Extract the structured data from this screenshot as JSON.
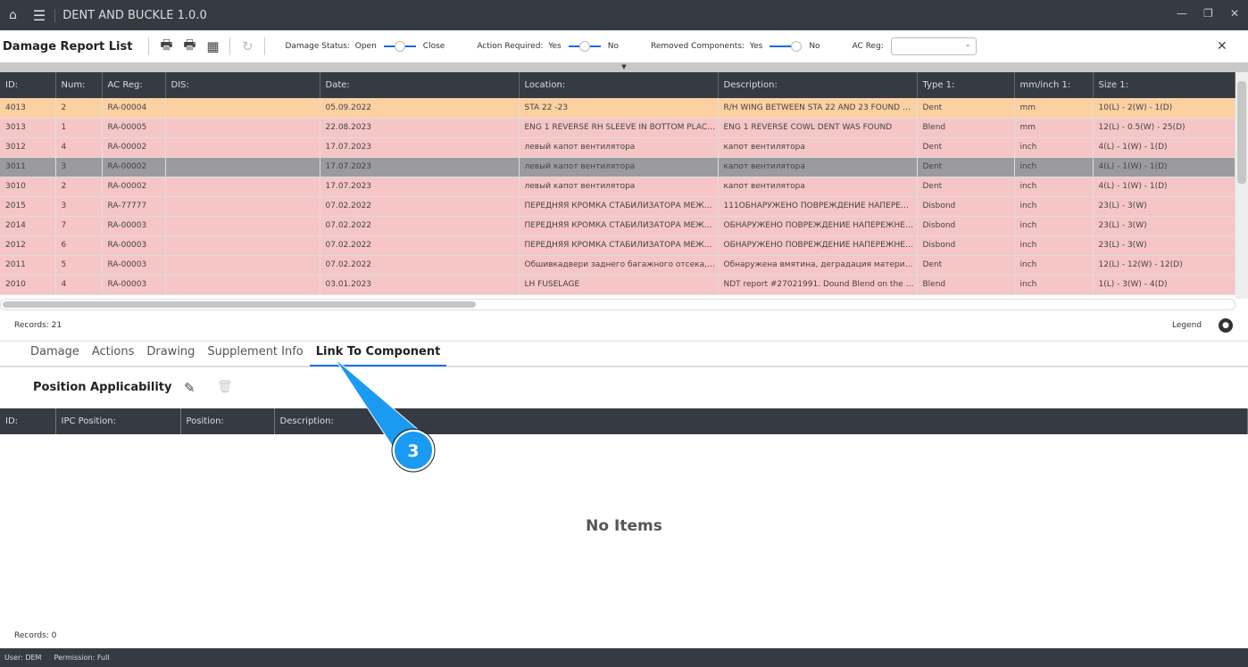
{
  "app": {
    "title": "DENT AND BUCKLE 1.0.0"
  },
  "toolbar": {
    "title": "Damage Report List",
    "damage_status": {
      "label": "Damage Status:",
      "left": "Open",
      "right": "Close"
    },
    "action_required": {
      "label": "Action Required:",
      "left": "Yes",
      "right": "No"
    },
    "removed_components": {
      "label": "Removed Components:",
      "left": "Yes",
      "right": "No"
    },
    "ac_reg": {
      "label": "AC Reg:",
      "value": ""
    },
    "close": "✕"
  },
  "grid": {
    "columns": [
      "ID:",
      "Num:",
      "AC Reg:",
      "DIS:",
      "Date:",
      "Location:",
      "Description:",
      "Type 1:",
      "mm/inch 1:",
      "Size 1:"
    ],
    "rows": [
      {
        "state": "orange",
        "cells": [
          "4013",
          "2",
          "RA-00004",
          "",
          "05.09.2022",
          "STA 22 -23",
          "R/H WING BETWEEN STA 22 AND 23 FOUND DE...",
          "Dent",
          "mm",
          "10(L) - 2(W) - 1(D)"
        ]
      },
      {
        "state": "pink",
        "cells": [
          "3013",
          "1",
          "RA-00005",
          "",
          "22.08.2023",
          "ENG 1 REVERSE RH SLEEVE IN BOTTOM PLACE...",
          "ENG 1 REVERSE COWL DENT WAS FOUND",
          "Blend",
          "mm",
          "12(L) - 0.5(W) - 25(D)"
        ]
      },
      {
        "state": "pink",
        "cells": [
          "3012",
          "4",
          "RA-00002",
          "",
          "17.07.2023",
          "левый капот вентилятора",
          "капот вентилятора",
          "Dent",
          "inch",
          "4(L) - 1(W) - 1(D)"
        ]
      },
      {
        "state": "sel",
        "cells": [
          "3011",
          "3",
          "RA-00002",
          "",
          "17.07.2023",
          "левый капот вентилятора",
          "капот вентилятора",
          "Dent",
          "inch",
          "4(L) - 1(W) - 1(D)"
        ]
      },
      {
        "state": "pink",
        "cells": [
          "3010",
          "2",
          "RA-00002",
          "",
          "17.07.2023",
          "левый капот вентилятора",
          "капот вентилятора",
          "Dent",
          "inch",
          "4(L) - 1(W) - 1(D)"
        ]
      },
      {
        "state": "pink",
        "cells": [
          "2015",
          "3",
          "RA-77777",
          "",
          "07.02.2022",
          "ПЕРЕДНЯЯ КРОМКА СТАБИЛИЗАТОРА МЕЖДУ...",
          "111ОБНАРУЖЕНО ПОВРЕЖДЕНИЕ НАПЕРЕЖН...",
          "Disbond",
          "inch",
          "23(L) - 3(W)"
        ]
      },
      {
        "state": "pink",
        "cells": [
          "2014",
          "7",
          "RA-00003",
          "",
          "07.02.2022",
          "ПЕРЕДНЯЯ КРОМКА СТАБИЛИЗАТОРА МЕЖДУ...",
          "ОБНАРУЖЕНО ПОВРЕЖДЕНИЕ НАПЕРЕЖНЕЙ...",
          "Disbond",
          "inch",
          "23(L) - 3(W)"
        ]
      },
      {
        "state": "pink",
        "cells": [
          "2012",
          "6",
          "RA-00003",
          "",
          "07.02.2022",
          "ПЕРЕДНЯЯ КРОМКА СТАБИЛИЗАТОРА МЕЖДУ...",
          "ОБНАРУЖЕНО ПОВРЕЖДЕНИЕ НАПЕРЕЖНЕЙ...",
          "Disbond",
          "inch",
          "23(L) - 3(W)"
        ]
      },
      {
        "state": "pink",
        "cells": [
          "2011",
          "5",
          "RA-00003",
          "",
          "07.02.2022",
          "Обшивкадвери заднего багажного отсека, ме...",
          "Обнаружена вмятина,  деградация материала...",
          "Dent",
          "inch",
          "12(L) - 12(W) - 12(D)"
        ]
      },
      {
        "state": "pink",
        "cells": [
          "2010",
          "4",
          "RA-00003",
          "",
          "03.01.2023",
          "LH FUSELAGE",
          "NDT report #27021991. Dound Blend on the fus...",
          "Blend",
          "inch",
          "1(L) - 3(W) - 4(D)"
        ]
      }
    ],
    "records": "Records: 21",
    "legend": "Legend"
  },
  "tabs": [
    "Damage",
    "Actions",
    "Drawing",
    "Supplement Info",
    "Link To Component"
  ],
  "position": {
    "title": "Position Applicability",
    "columns": [
      "ID:",
      "IPC Position:",
      "Position:",
      "Description:"
    ],
    "empty": "No Items",
    "records": "Records: 0"
  },
  "footer": {
    "user": "User: DEM",
    "permission": "Permission: Full"
  },
  "callout": {
    "number": "3",
    "color": "#1a9af0"
  }
}
